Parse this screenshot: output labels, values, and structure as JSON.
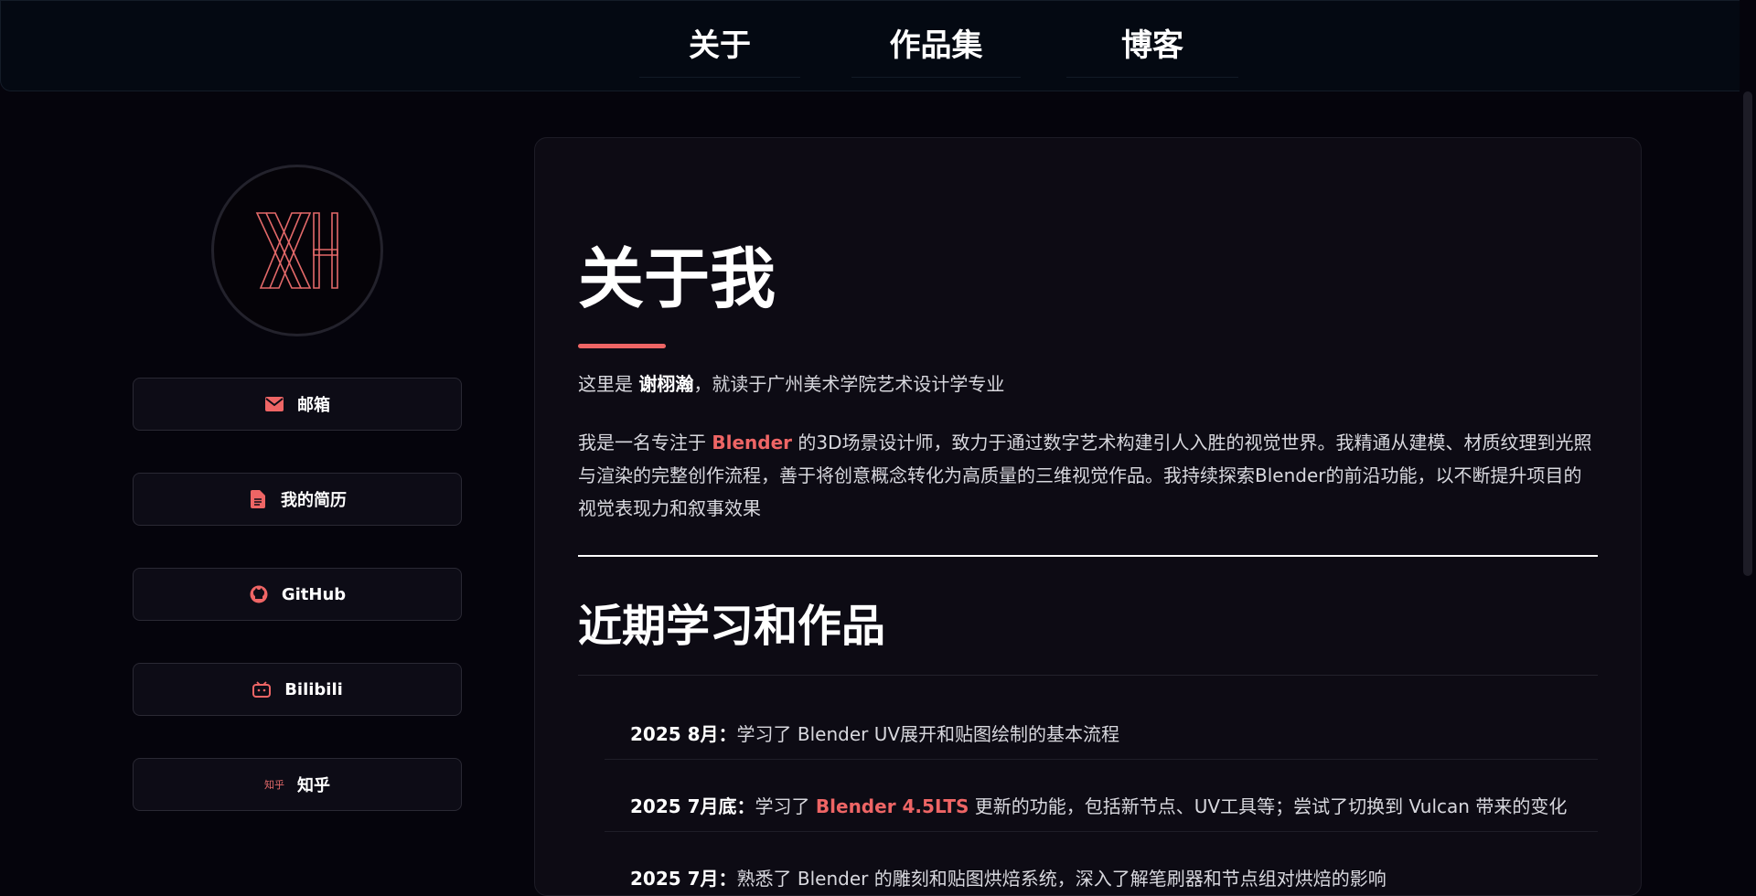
{
  "nav": {
    "items": [
      {
        "label": "关于"
      },
      {
        "label": "作品集"
      },
      {
        "label": "博客"
      }
    ]
  },
  "profile": {
    "avatar_mark": "XH",
    "links": [
      {
        "label": "邮箱",
        "icon": "envelope-icon"
      },
      {
        "label": "我的简历",
        "icon": "document-icon"
      },
      {
        "label": "GitHub",
        "icon": "github-icon"
      },
      {
        "label": "Bilibili",
        "icon": "bilibili-icon"
      },
      {
        "label": "知乎",
        "icon": "zhihu-icon",
        "icon_text": "知乎"
      }
    ]
  },
  "about": {
    "title": "关于我",
    "intro_prefix": "这里是 ",
    "intro_name": "谢栩瀚",
    "intro_suffix": "，就读于广州美术学院艺术设计学专业",
    "para_prefix": "我是一名专注于 ",
    "para_highlight": "Blender",
    "para_suffix": " 的3D场景设计师，致力于通过数字艺术构建引人入胜的视觉世界。我精通从建模、材质纹理到光照与渲染的完整创作流程，善于将创意概念转化为高质量的三维视觉作品。我持续探索Blender的前沿功能，以不断提升项目的视觉表现力和叙事效果"
  },
  "recent": {
    "title": "近期学习和作品",
    "items": [
      {
        "date": "2025 8月",
        "sep": "：",
        "text_prefix": "学习了 Blender UV展开和贴图绘制的基本流程",
        "highlight": "",
        "text_suffix": ""
      },
      {
        "date": "2025 7月底",
        "sep": "：",
        "text_prefix": "学习了 ",
        "highlight": "Blender 4.5LTS",
        "text_suffix": " 更新的功能，包括新节点、UV工具等；尝试了切换到 Vulcan 带来的变化"
      },
      {
        "date": "2025 7月",
        "sep": "：",
        "text_prefix": "熟悉了 Blender 的雕刻和贴图烘焙系统，深入了解笔刷器和节点组对烘焙的影响",
        "highlight": "",
        "text_suffix": ""
      }
    ]
  },
  "colors": {
    "accent": "#ee6565",
    "background": "#05040c",
    "card": "#0d0b14",
    "nav_bg": "#040912"
  }
}
